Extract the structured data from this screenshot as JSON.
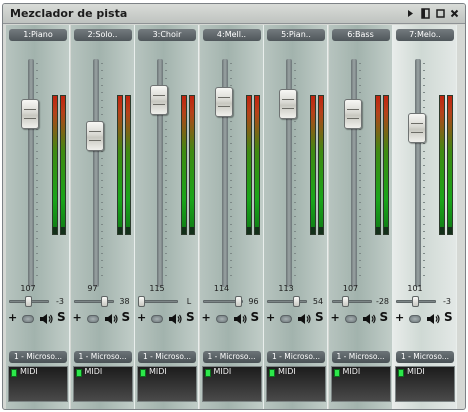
{
  "window": {
    "title": "Mezclador de pista"
  },
  "titlebar_icons": [
    "play-icon",
    "dock-icon",
    "restore-icon",
    "close-icon"
  ],
  "strips": [
    {
      "name": "1:Piano",
      "volume": "107",
      "pan": "-3",
      "device": "1 - Microso...",
      "port_label": "MIDI",
      "fader_level": 0.8,
      "pan_position": 0.47,
      "selected": false
    },
    {
      "name": "2:Solo..",
      "volume": "97",
      "pan": "38",
      "device": "1 - Microso...",
      "port_label": "MIDI",
      "fader_level": 0.69,
      "pan_position": 0.8,
      "selected": false
    },
    {
      "name": "3:Choir",
      "volume": "115",
      "pan": "L",
      "device": "1 - Microso...",
      "port_label": "MIDI",
      "fader_level": 0.87,
      "pan_position": 0.0,
      "selected": false
    },
    {
      "name": "4:Mell..",
      "volume": "114",
      "pan": "96",
      "device": "1 - Microso...",
      "port_label": "MIDI",
      "fader_level": 0.86,
      "pan_position": 0.96,
      "selected": false
    },
    {
      "name": "5:Pian..",
      "volume": "113",
      "pan": "54",
      "device": "1 - Microso...",
      "port_label": "MIDI",
      "fader_level": 0.85,
      "pan_position": 0.75,
      "selected": false
    },
    {
      "name": "6:Bass",
      "volume": "107",
      "pan": "-28",
      "device": "1 - Microso...",
      "port_label": "MIDI",
      "fader_level": 0.8,
      "pan_position": 0.3,
      "selected": false
    },
    {
      "name": "7:Melo..",
      "volume": "101",
      "pan": "-3",
      "device": "1 - Microso...",
      "port_label": "MIDI",
      "fader_level": 0.73,
      "pan_position": 0.47,
      "selected": true
    }
  ],
  "controls": {
    "add_label": "+",
    "solo_label": "S"
  },
  "colors": {
    "meter_red": "#c1240f",
    "meter_green": "#1aa51a",
    "midi_led": "#2ce84a",
    "tab_bg": "#5c6468"
  }
}
